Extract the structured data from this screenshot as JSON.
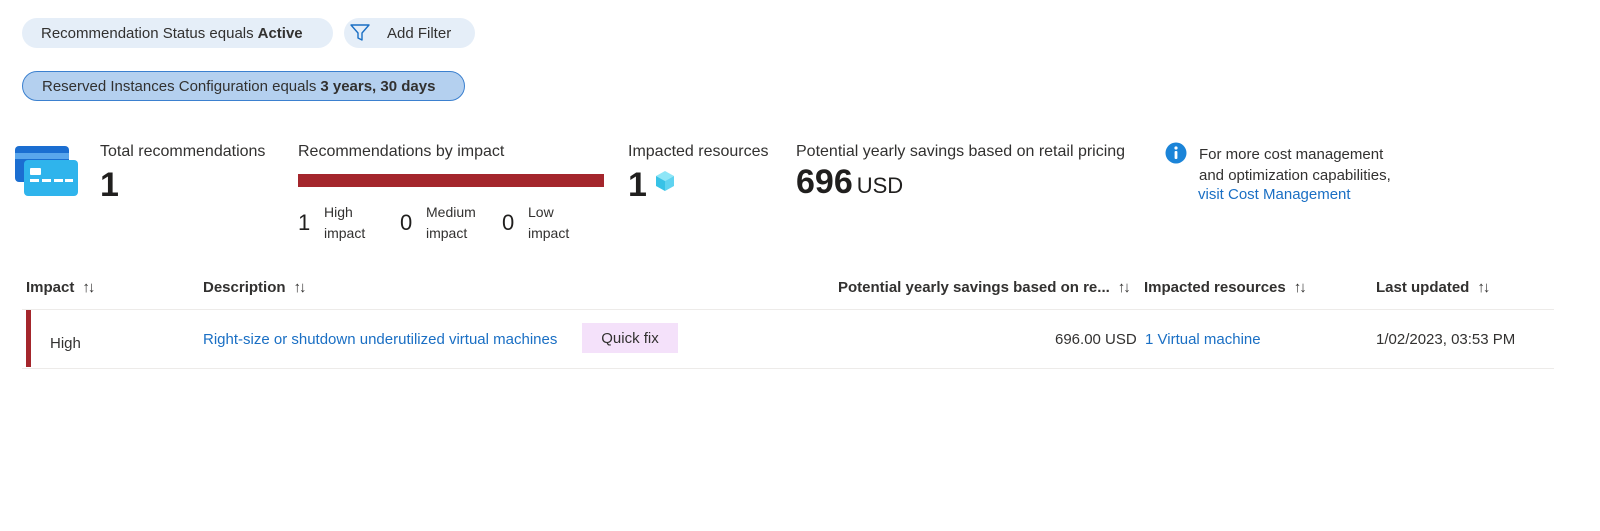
{
  "filters": {
    "status": {
      "text": "Recommendation Status equals",
      "value": "Active"
    },
    "add_filter": {
      "label": "Add Filter",
      "icon": "filter-icon"
    },
    "reserved_instances": {
      "text": "Reserved Instances Configuration equals",
      "value": "3 years, 30 days"
    }
  },
  "summary": {
    "cost_icon": "credit-card-icon",
    "total": {
      "label": "Total recommendations",
      "value": "1"
    },
    "by_impact": {
      "label": "Recommendations by impact",
      "bar_color": "#a4262c",
      "high": {
        "count": "1",
        "line1": "High",
        "line2": "impact"
      },
      "medium": {
        "count": "0",
        "line1": "Medium",
        "line2": "impact"
      },
      "low": {
        "count": "0",
        "line1": "Low",
        "line2": "impact"
      }
    },
    "impacted": {
      "label": "Impacted resources",
      "value": "1",
      "icon": "cube-icon"
    },
    "savings": {
      "label": "Potential yearly savings based on retail pricing",
      "value": "696",
      "unit": "USD"
    },
    "info": {
      "icon": "info-icon",
      "line1": "For more cost management",
      "line2": "and optimization capabilities,",
      "link": "visit Cost Management"
    }
  },
  "table": {
    "sort_icon": "↑↓",
    "columns": {
      "impact": "Impact",
      "description": "Description",
      "savings": "Potential yearly savings based on re...",
      "resources": "Impacted resources",
      "updated": "Last updated"
    },
    "rows": [
      {
        "impact": "High",
        "description": "Right-size or shutdown underutilized virtual machines",
        "action": "Quick fix",
        "savings": "696.00 USD",
        "resources": "1 Virtual machine",
        "updated": "1/02/2023, 03:53 PM"
      }
    ]
  },
  "colors": {
    "accent_link": "#1a6fc4",
    "high_impact": "#a4262c",
    "pill_bg": "#e5eef8",
    "pill_selected_bg": "#b4d0ef",
    "quick_fix_bg": "#f4e1fa"
  }
}
